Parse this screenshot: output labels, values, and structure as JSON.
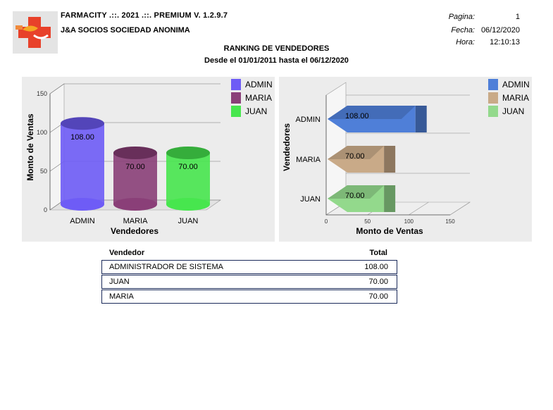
{
  "header": {
    "app_title": "FARMACITY .::. 2021 .::.  PREMIUM  V.  1.2.9.7",
    "company": "J&A SOCIOS SOCIEDAD ANONIMA",
    "pagina_label": "Pagina:",
    "pagina_value": "1",
    "fecha_label": "Fecha:",
    "fecha_value": "06/12/2020",
    "hora_label": "Hora:",
    "hora_value": "12:10:13"
  },
  "report": {
    "title": "RANKING DE VENDEDORES",
    "subtitle": "Desde el 01/01/2011 hasta el 06/12/2020"
  },
  "chart_data": [
    {
      "type": "bar",
      "orientation": "vertical",
      "categories": [
        "ADMIN",
        "MARIA",
        "JUAN"
      ],
      "values": [
        108.0,
        70.0,
        70.0
      ],
      "value_labels": [
        "108.00",
        "70.00",
        "70.00"
      ],
      "xlabel": "Vendedores",
      "ylabel": "Monto de Ventas",
      "ylim": [
        0,
        150
      ],
      "yticks": [
        "0",
        "50",
        "100",
        "150"
      ],
      "legend": [
        "ADMIN",
        "MARIA",
        "JUAN"
      ],
      "legend_position": "top-right",
      "colors": [
        "#6e5cf6",
        "#8a3f78",
        "#47e64e"
      ],
      "grid": true
    },
    {
      "type": "bar",
      "orientation": "horizontal",
      "categories": [
        "ADMIN",
        "MARIA",
        "JUAN"
      ],
      "values": [
        108.0,
        70.0,
        70.0
      ],
      "value_labels": [
        "108.00",
        "70.00",
        "70.00"
      ],
      "xlabel": "Monto de Ventas",
      "ylabel": "Vendedores",
      "xlim": [
        0,
        150
      ],
      "xticks": [
        "0",
        "50",
        "100",
        "150"
      ],
      "legend": [
        "ADMIN",
        "MARIA",
        "JUAN"
      ],
      "legend_position": "top-right",
      "colors": [
        "#4f7fd8",
        "#c9aa88",
        "#93d98c"
      ],
      "grid": true
    }
  ],
  "table": {
    "headers": [
      "Vendedor",
      "Total"
    ],
    "rows": [
      [
        "ADMINISTRADOR DE SISTEMA",
        "108.00"
      ],
      [
        "JUAN",
        "70.00"
      ],
      [
        "MARIA",
        "70.00"
      ]
    ]
  }
}
